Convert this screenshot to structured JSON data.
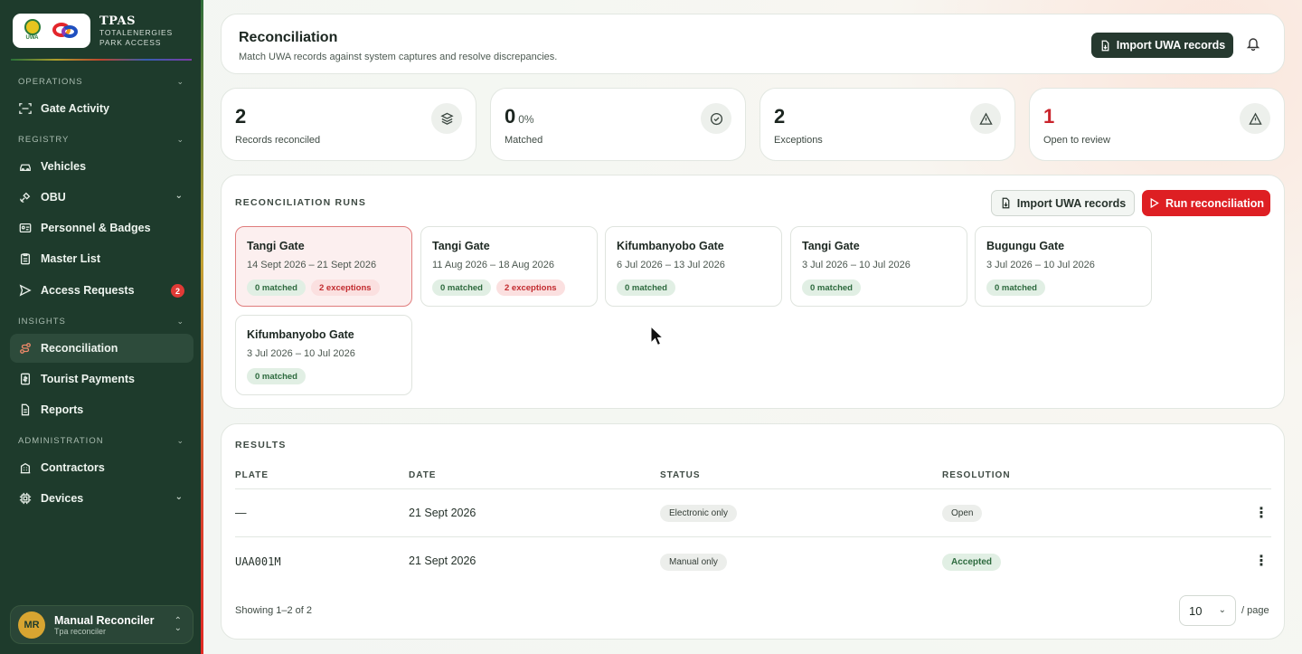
{
  "brand": {
    "title": "TPAS",
    "sub_line1": "TOTALENERGIES",
    "sub_line2": "PARK ACCESS",
    "uwa_logo_text": "UWA"
  },
  "sidebar": {
    "sections": {
      "operations": "OPERATIONS",
      "registry": "REGISTRY",
      "insights": "INSIGHTS",
      "administration": "ADMINISTRATION"
    },
    "items": [
      {
        "label": "Gate Activity",
        "icon": "scan-icon"
      },
      {
        "label": "Vehicles",
        "icon": "car-icon"
      },
      {
        "label": "OBU",
        "icon": "satellite-icon"
      },
      {
        "label": "Personnel & Badges",
        "icon": "id-card-icon"
      },
      {
        "label": "Master List",
        "icon": "clipboard-icon"
      },
      {
        "label": "Access Requests",
        "icon": "send-icon",
        "badge": "2"
      },
      {
        "label": "Reconciliation",
        "icon": "route-icon",
        "active": true
      },
      {
        "label": "Tourist Payments",
        "icon": "receipt-icon"
      },
      {
        "label": "Reports",
        "icon": "file-icon"
      },
      {
        "label": "Contractors",
        "icon": "building-icon"
      },
      {
        "label": "Devices",
        "icon": "cpu-icon"
      }
    ],
    "user": {
      "initials": "MR",
      "name": "Manual Reconciler",
      "role": "Tpa reconciler"
    }
  },
  "header": {
    "title": "Reconciliation",
    "subtitle": "Match UWA records against system captures and resolve discrepancies.",
    "import_button": "Import UWA records"
  },
  "stats": [
    {
      "value": "2",
      "suffix": "",
      "label": "Records reconciled",
      "icon": "layers-icon"
    },
    {
      "value": "0",
      "suffix": "0%",
      "label": "Matched",
      "icon": "check-circle-icon"
    },
    {
      "value": "2",
      "suffix": "",
      "label": "Exceptions",
      "icon": "alert-triangle-icon"
    },
    {
      "value": "1",
      "suffix": "",
      "label": "Open to review",
      "icon": "alert-triangle-icon"
    }
  ],
  "runs": {
    "section_label": "RECONCILIATION RUNS",
    "import_button": "Import UWA records",
    "run_button": "Run reconciliation",
    "items": [
      {
        "gate": "Tangi Gate",
        "dates": "14 Sept 2026 – 21 Sept 2026",
        "matched": "0 matched",
        "exceptions": "2 exceptions"
      },
      {
        "gate": "Tangi Gate",
        "dates": "11 Aug 2026 – 18 Aug 2026",
        "matched": "0 matched",
        "exceptions": "2 exceptions"
      },
      {
        "gate": "Kifumbanyobo Gate",
        "dates": "6 Jul 2026 – 13 Jul 2026",
        "matched": "0 matched"
      },
      {
        "gate": "Tangi Gate",
        "dates": "3 Jul 2026 – 10 Jul 2026",
        "matched": "0 matched"
      },
      {
        "gate": "Bugungu Gate",
        "dates": "3 Jul 2026 – 10 Jul 2026",
        "matched": "0 matched"
      },
      {
        "gate": "Kifumbanyobo Gate",
        "dates": "3 Jul 2026 – 10 Jul 2026",
        "matched": "0 matched"
      }
    ]
  },
  "results": {
    "section_label": "RESULTS",
    "columns": [
      "PLATE",
      "DATE",
      "STATUS",
      "RESOLUTION"
    ],
    "rows": [
      {
        "plate": "—",
        "date": "21 Sept 2026",
        "status": "Electronic only",
        "resolution": "Open"
      },
      {
        "plate": "UAA001M",
        "date": "21 Sept 2026",
        "status": "Manual only",
        "resolution": "Accepted"
      }
    ],
    "showing": "Showing 1–2 of 2",
    "page_size": "10",
    "per_page": "/ page"
  }
}
